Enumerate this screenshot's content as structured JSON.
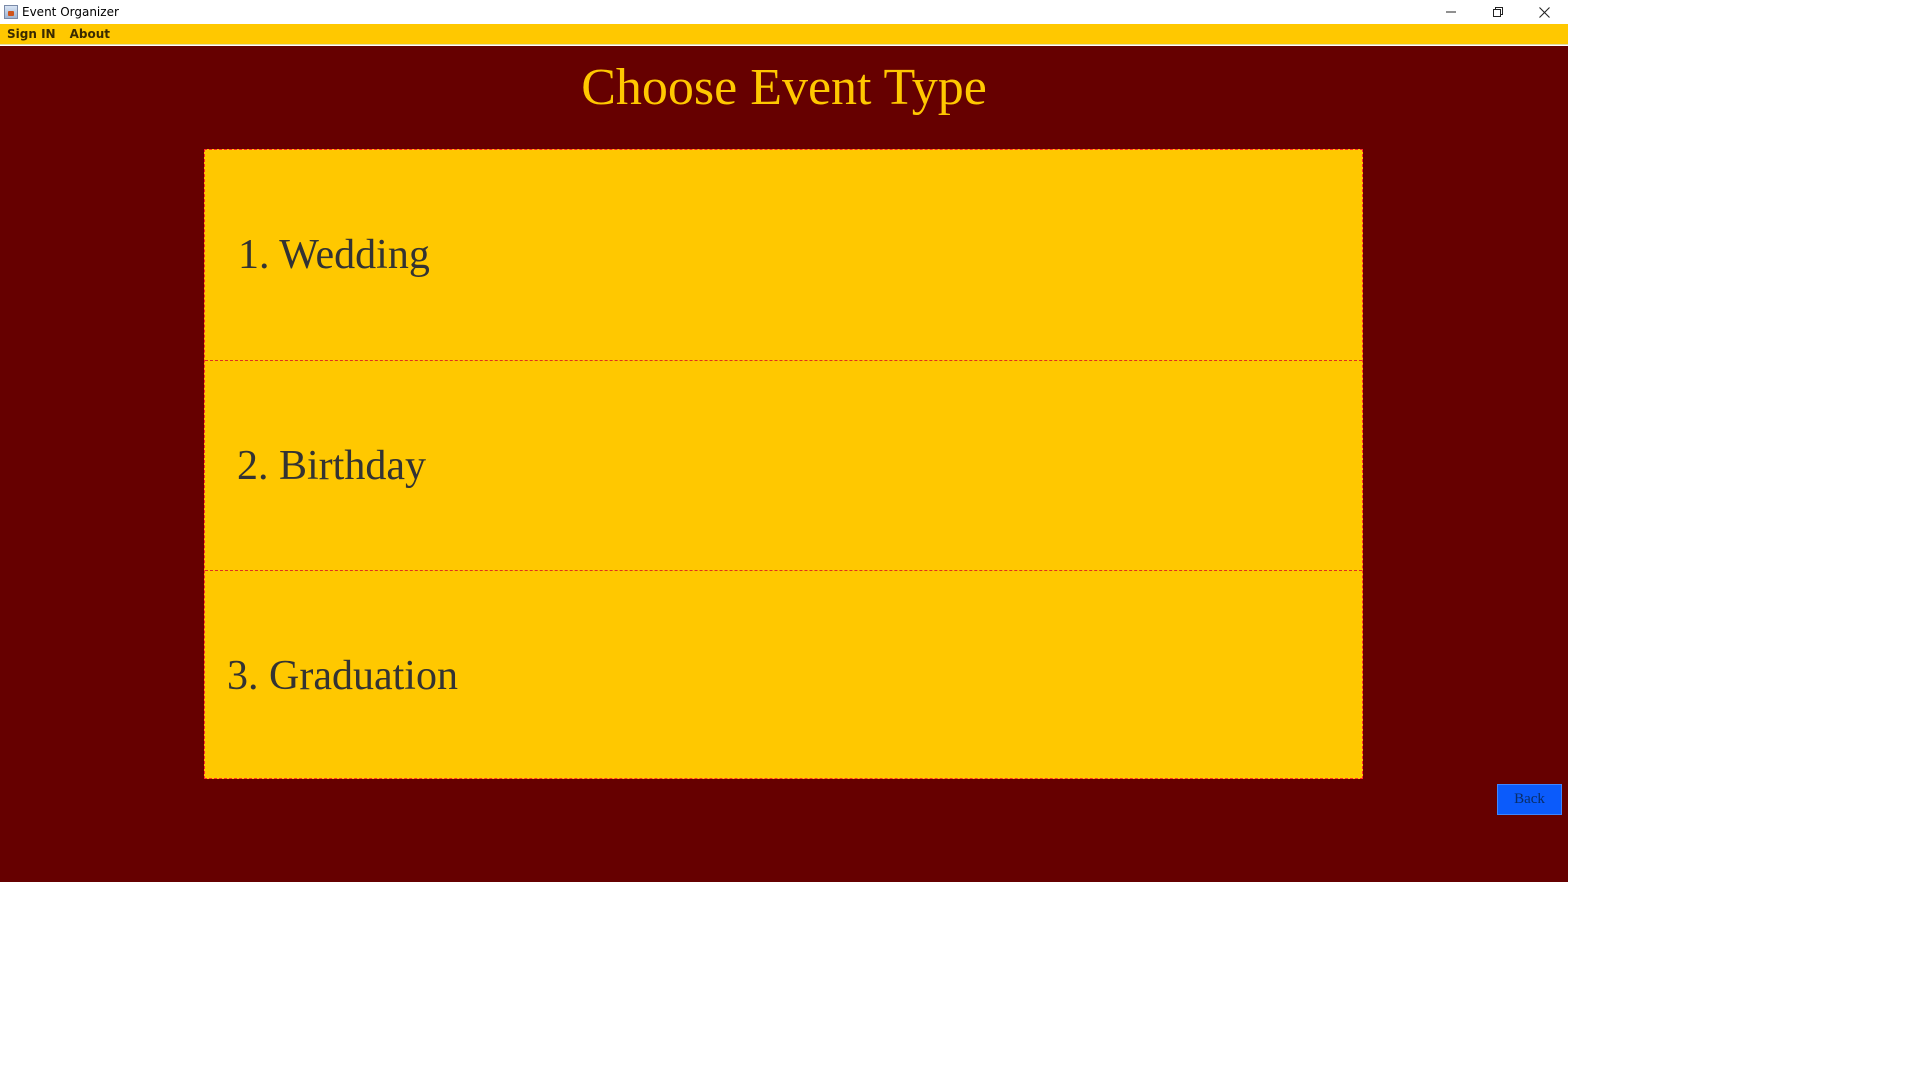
{
  "window": {
    "title": "Event Organizer",
    "controls": {
      "minimize_icon": "minimize-icon",
      "restore_icon": "restore-icon",
      "close_icon": "close-icon"
    }
  },
  "menubar": {
    "items": [
      {
        "label": "Sign IN"
      },
      {
        "label": "About"
      }
    ]
  },
  "main": {
    "title": "Choose Event Type",
    "options": [
      {
        "label": "1. Wedding"
      },
      {
        "label": "2. Birthday"
      },
      {
        "label": "3. Graduation"
      }
    ],
    "back_label": "Back"
  },
  "colors": {
    "background": "#660000",
    "accent": "#ffc800",
    "option_text": "#333333",
    "back_button": "#0b5bfb",
    "divider": "#e0301e"
  }
}
